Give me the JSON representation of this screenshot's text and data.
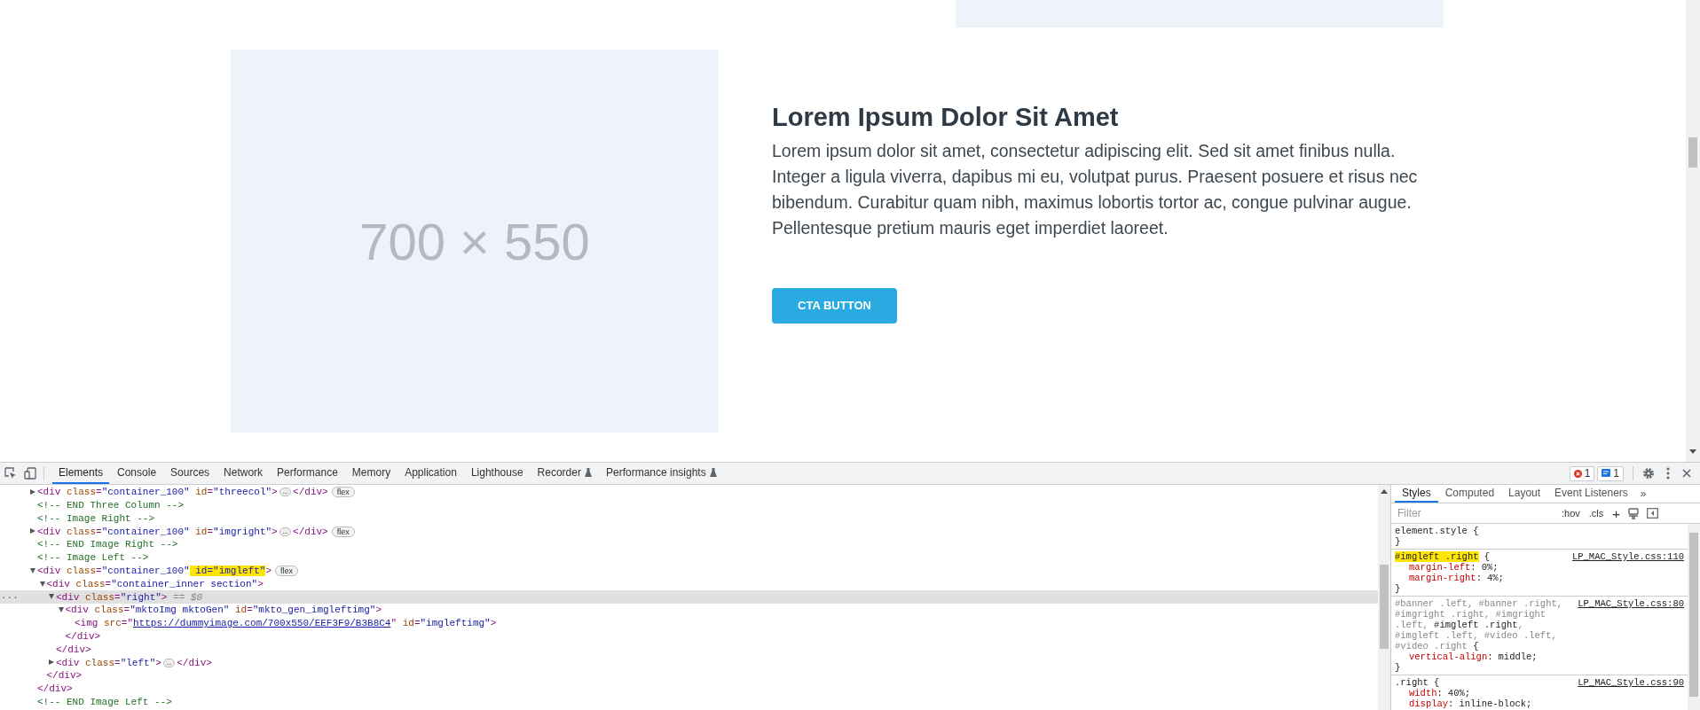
{
  "page": {
    "image_label": "700 × 550",
    "heading": "Lorem Ipsum Dolor Sit Amet",
    "paragraph": "Lorem ipsum dolor sit amet, consectetur adipiscing elit. Sed sit amet finibus nulla. Integer a ligula viverra, dapibus mi eu, volutpat purus. Praesent posuere et risus nec bibendum. Curabitur quam nibh, maximus lobortis tortor ac, congue pulvinar augue. Pellentesque pretium mauris eget imperdiet laoreet.",
    "cta": "CTA BUTTON"
  },
  "devtools": {
    "tabs": [
      {
        "label": "Elements",
        "selected": true,
        "experimental": false
      },
      {
        "label": "Console",
        "selected": false,
        "experimental": false
      },
      {
        "label": "Sources",
        "selected": false,
        "experimental": false
      },
      {
        "label": "Network",
        "selected": false,
        "experimental": false
      },
      {
        "label": "Performance",
        "selected": false,
        "experimental": false
      },
      {
        "label": "Memory",
        "selected": false,
        "experimental": false
      },
      {
        "label": "Application",
        "selected": false,
        "experimental": false
      },
      {
        "label": "Lighthouse",
        "selected": false,
        "experimental": false
      },
      {
        "label": "Recorder",
        "selected": false,
        "experimental": true
      },
      {
        "label": "Performance insights",
        "selected": false,
        "experimental": true
      }
    ],
    "errors": "1",
    "messages": "1",
    "dom": [
      {
        "kind": "element",
        "expanded": false,
        "selected": false,
        "segments": [
          {
            "kind": "tag",
            "text": "<div"
          },
          {
            "kind": "attr",
            "text": " class"
          },
          {
            "kind": "punct",
            "text": "="
          },
          {
            "kind": "val",
            "text": "\"container_100\""
          },
          {
            "kind": "attr",
            "text": " id"
          },
          {
            "kind": "punct",
            "text": "="
          },
          {
            "kind": "val",
            "text": "\"threecol\""
          },
          {
            "kind": "tag",
            "text": ">"
          },
          {
            "kind": "ellipsis",
            "text": "…"
          },
          {
            "kind": "tag",
            "text": "</div>"
          }
        ],
        "badge": "flex"
      },
      {
        "kind": "comment",
        "selected": false,
        "segments": [
          {
            "kind": "comment",
            "text": "<!-- END Three Column -->"
          }
        ]
      },
      {
        "kind": "comment",
        "selected": false,
        "segments": [
          {
            "kind": "comment",
            "text": "<!-- Image Right -->"
          }
        ]
      },
      {
        "kind": "element",
        "expanded": false,
        "selected": false,
        "segments": [
          {
            "kind": "tag",
            "text": "<div"
          },
          {
            "kind": "attr",
            "text": " class"
          },
          {
            "kind": "punct",
            "text": "="
          },
          {
            "kind": "val",
            "text": "\"container_100\""
          },
          {
            "kind": "attr",
            "text": " id"
          },
          {
            "kind": "punct",
            "text": "="
          },
          {
            "kind": "val",
            "text": "\"imgright\""
          },
          {
            "kind": "tag",
            "text": ">"
          },
          {
            "kind": "ellipsis",
            "text": "…"
          },
          {
            "kind": "tag",
            "text": "</div>"
          }
        ],
        "badge": "flex"
      },
      {
        "kind": "comment",
        "selected": false,
        "segments": [
          {
            "kind": "comment",
            "text": "<!-- END Image Right -->"
          }
        ]
      },
      {
        "kind": "comment",
        "selected": false,
        "segments": [
          {
            "kind": "comment",
            "text": "<!-- Image Left -->"
          }
        ]
      },
      {
        "kind": "element",
        "expanded": true,
        "selected": false,
        "segments": [
          {
            "kind": "tag",
            "text": "<div"
          },
          {
            "kind": "attr",
            "text": " class"
          },
          {
            "kind": "punct",
            "text": "="
          },
          {
            "kind": "val",
            "text": "\"container_100\""
          },
          {
            "kind": "hl",
            "text": " id=\"imgleft\""
          },
          {
            "kind": "tag",
            "text": ">"
          }
        ],
        "badge": "flex",
        "closing": "</div>",
        "children": [
          {
            "kind": "element",
            "expanded": true,
            "selected": false,
            "segments": [
              {
                "kind": "tag",
                "text": "<div"
              },
              {
                "kind": "attr",
                "text": " class"
              },
              {
                "kind": "punct",
                "text": "="
              },
              {
                "kind": "val",
                "text": "\"container_inner section\""
              },
              {
                "kind": "tag",
                "text": ">"
              }
            ],
            "closing": "</div>",
            "children": [
              {
                "kind": "element",
                "expanded": true,
                "selected": true,
                "gutter": "···",
                "segments": [
                  {
                    "kind": "tag",
                    "text": "<div"
                  },
                  {
                    "kind": "attr",
                    "text": " class"
                  },
                  {
                    "kind": "punct",
                    "text": "="
                  },
                  {
                    "kind": "val",
                    "text": "\"right\""
                  },
                  {
                    "kind": "tag",
                    "text": ">"
                  },
                  {
                    "kind": "note",
                    "text": " == $0"
                  }
                ],
                "closing": "</div>",
                "children": [
                  {
                    "kind": "element",
                    "expanded": true,
                    "selected": false,
                    "segments": [
                      {
                        "kind": "tag",
                        "text": "<div"
                      },
                      {
                        "kind": "attr",
                        "text": " class"
                      },
                      {
                        "kind": "punct",
                        "text": "="
                      },
                      {
                        "kind": "val",
                        "text": "\"mktoImg mktoGen\""
                      },
                      {
                        "kind": "attr",
                        "text": " id"
                      },
                      {
                        "kind": "punct",
                        "text": "="
                      },
                      {
                        "kind": "val",
                        "text": "\"mkto_gen_imgleftimg\""
                      },
                      {
                        "kind": "tag",
                        "text": ">"
                      }
                    ],
                    "closing": "</div>",
                    "children": [
                      {
                        "kind": "leaf",
                        "selected": false,
                        "segments": [
                          {
                            "kind": "tag",
                            "text": "<img"
                          },
                          {
                            "kind": "attr",
                            "text": " src"
                          },
                          {
                            "kind": "punct",
                            "text": "=\""
                          },
                          {
                            "kind": "link",
                            "text": "https://dummyimage.com/700x550/EEF3F9/B3B8C4"
                          },
                          {
                            "kind": "punct",
                            "text": "\""
                          },
                          {
                            "kind": "attr",
                            "text": " id"
                          },
                          {
                            "kind": "punct",
                            "text": "="
                          },
                          {
                            "kind": "val",
                            "text": "\"imgleftimg\""
                          },
                          {
                            "kind": "tag",
                            "text": ">"
                          }
                        ]
                      }
                    ]
                  }
                ]
              },
              {
                "kind": "element",
                "expanded": false,
                "selected": false,
                "segments": [
                  {
                    "kind": "tag",
                    "text": "<div"
                  },
                  {
                    "kind": "attr",
                    "text": " class"
                  },
                  {
                    "kind": "punct",
                    "text": "="
                  },
                  {
                    "kind": "val",
                    "text": "\"left\""
                  },
                  {
                    "kind": "tag",
                    "text": ">"
                  },
                  {
                    "kind": "ellipsis",
                    "text": "…"
                  },
                  {
                    "kind": "tag",
                    "text": "</div>"
                  }
                ]
              }
            ]
          }
        ]
      },
      {
        "kind": "comment",
        "selected": false,
        "segments": [
          {
            "kind": "comment",
            "text": "<!-- END Image Left -->"
          }
        ]
      }
    ],
    "side_tabs": [
      {
        "label": "Styles",
        "selected": true
      },
      {
        "label": "Computed",
        "selected": false
      },
      {
        "label": "Layout",
        "selected": false
      },
      {
        "label": "Event Listeners",
        "selected": false
      }
    ],
    "side_more": "»",
    "filter_placeholder": "Filter",
    "hov": ":hov",
    "cls": ".cls",
    "add": "+",
    "rules": [
      {
        "selector": [
          {
            "text": "element.style",
            "matched": true
          }
        ],
        "highlighted": false,
        "open": "{",
        "close": "}"
      },
      {
        "selector": [
          {
            "text": "#imgleft .right",
            "matched": true
          }
        ],
        "highlighted": true,
        "open": "{",
        "close": "}",
        "source": "LP_MAC_Style.css:110",
        "declarations": [
          {
            "prop": "margin-left",
            "colon": ":",
            "value": "0%;"
          },
          {
            "prop": "margin-right",
            "colon": ":",
            "value": "4%;"
          }
        ]
      },
      {
        "selector": [
          {
            "text": "#banner .left, #banner .right, #imgright .right, #imgright .left, ",
            "matched": false
          },
          {
            "text": "#imgleft .right",
            "matched": true
          },
          {
            "text": ", #imgleft .left, #video .left, #video .right",
            "matched": false
          }
        ],
        "highlighted": false,
        "open": "{",
        "close": "}",
        "source": "LP_MAC_Style.css:80",
        "declarations": [
          {
            "prop": "vertical-align",
            "colon": ":",
            "value": "middle;"
          }
        ]
      },
      {
        "selector": [
          {
            "text": ".right",
            "matched": true
          }
        ],
        "highlighted": false,
        "open": "{",
        "source": "LP_MAC_Style.css:90",
        "declarations": [
          {
            "prop": "width",
            "colon": ":",
            "value": "40%;"
          },
          {
            "prop": "display",
            "colon": ":",
            "value": "inline-block;"
          }
        ]
      }
    ]
  }
}
